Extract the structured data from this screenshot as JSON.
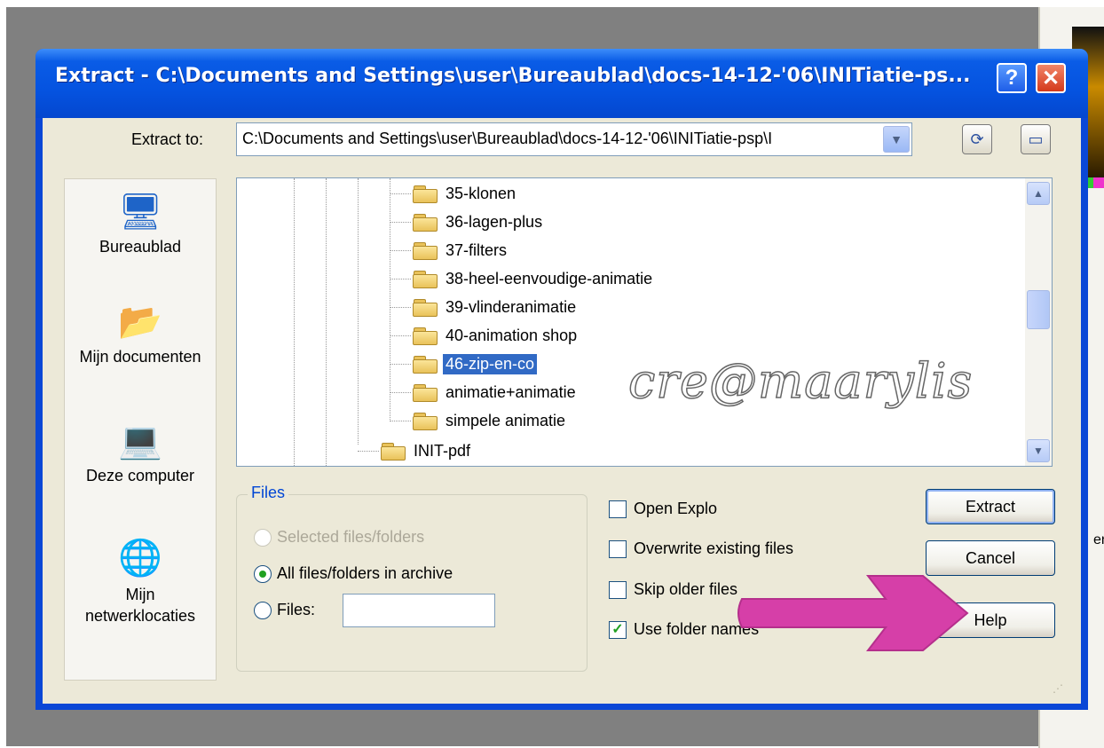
{
  "window": {
    "title": "Extract - C:\\Documents and Settings\\user\\Bureaublad\\docs-14-12-'06\\INITiatie-ps...",
    "help_glyph": "?",
    "close_glyph": "✕"
  },
  "extract_to": {
    "label": "Extract to:",
    "value": "C:\\Documents and Settings\\user\\Bureaublad\\docs-14-12-'06\\INITiatie-psp\\I"
  },
  "places": [
    {
      "label": "Bureaublad",
      "icon": "desktop-icon"
    },
    {
      "label": "Mijn documenten",
      "icon": "my-documents-icon"
    },
    {
      "label": "Deze computer",
      "icon": "my-computer-icon"
    },
    {
      "label": "Mijn netwerklocaties",
      "icon": "network-places-icon"
    }
  ],
  "tree": {
    "items": [
      {
        "label": "35-klonen",
        "selected": false
      },
      {
        "label": "36-lagen-plus",
        "selected": false
      },
      {
        "label": "37-filters",
        "selected": false
      },
      {
        "label": "38-heel-eenvoudige-animatie",
        "selected": false
      },
      {
        "label": "39-vlinderanimatie",
        "selected": false
      },
      {
        "label": "40-animation shop",
        "selected": false
      },
      {
        "label": "46-zip-en-co",
        "selected": true
      },
      {
        "label": "animatie+animatie",
        "selected": false
      },
      {
        "label": "simpele animatie",
        "selected": false
      }
    ],
    "parent_item": "INIT-pdf"
  },
  "watermark": "cre@maarylis",
  "files_group": {
    "title": "Files",
    "options": [
      {
        "label": "Selected files/folders",
        "enabled": false,
        "checked": false
      },
      {
        "label": "All files/folders in archive",
        "enabled": true,
        "checked": true
      },
      {
        "label": "Files:",
        "enabled": true,
        "checked": false
      }
    ],
    "files_value": ""
  },
  "checkboxes": [
    {
      "label": "Open Explo",
      "checked": false
    },
    {
      "label": "Overwrite existing files",
      "checked": false
    },
    {
      "label": "Skip older files",
      "checked": false
    },
    {
      "label": "Use folder names",
      "checked": true
    }
  ],
  "buttons": {
    "extract": "Extract",
    "cancel": "Cancel",
    "help": "Help"
  },
  "colors": {
    "titlebar": "#0553e0",
    "selection": "#316ac5",
    "annotation_arrow": "#d63fa8"
  },
  "background": {
    "partial_text": "en"
  }
}
